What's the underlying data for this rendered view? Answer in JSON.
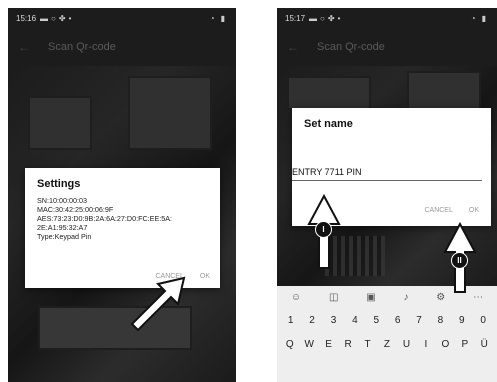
{
  "phone1": {
    "status_time": "15:16",
    "toolbar_title": "Scan Qr-code",
    "dialog": {
      "title": "Settings",
      "lines": [
        "SN:10:00:00:03",
        "MAC:30:42:25:00:06:9F",
        "AES:73:23:D0:9B:2A:6A:27:D0:FC:EE:5A:",
        "2E:A1:95:32:A7",
        "Type:Keypad Pin"
      ],
      "cancel_label": "CANCEL",
      "ok_label": "OK"
    }
  },
  "phone2": {
    "status_time": "15:17",
    "toolbar_title": "Scan Qr-code",
    "dialog": {
      "title": "Set name",
      "input_value": "ENTRY 7711 PIN",
      "cancel_label": "CANCEL",
      "ok_label": "OK"
    },
    "keyboard": {
      "toolbar_icons": [
        "emoji-icon",
        "sticker-icon",
        "gif-icon",
        "mic-icon",
        "settings-icon",
        "more-icon"
      ],
      "number_row": [
        "1",
        "2",
        "3",
        "4",
        "5",
        "6",
        "7",
        "8",
        "9",
        "0"
      ],
      "letter_row": [
        "Q",
        "W",
        "E",
        "R",
        "T",
        "Z",
        "U",
        "I",
        "O",
        "P",
        "Ü"
      ]
    }
  },
  "callouts": {
    "one": "I",
    "two": "II"
  }
}
